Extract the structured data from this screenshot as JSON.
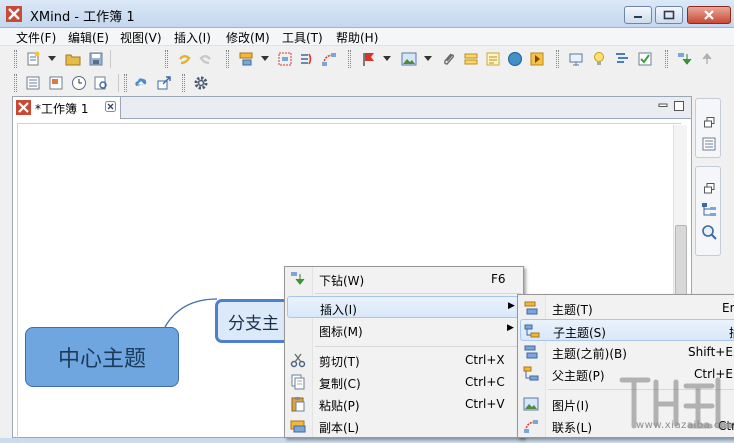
{
  "window": {
    "title": "XMind - 工作簿 1",
    "accent": "#c84a36"
  },
  "menubar": {
    "items": [
      "文件(F)",
      "编辑(E)",
      "视图(V)",
      "插入(I)",
      "修改(M)",
      "工具(T)",
      "帮助(H)"
    ]
  },
  "toolbar": {
    "icons": [
      "new-workbook-icon",
      "open-icon",
      "save-icon",
      "undo-icon",
      "redo-icon",
      "add-topic-icon",
      "insert-subtopic-icon",
      "boundary-icon",
      "summary-icon",
      "relationship-icon",
      "marker-flag-icon",
      "image-icon",
      "attachment-icon",
      "label-icon",
      "notes-icon",
      "hyperlink-globe-icon",
      "audio-icon",
      "presentation-icon",
      "idea-bulb-icon",
      "gantt-icon",
      "task-icon",
      "drill-down-icon",
      "drill-up-icon",
      "outline-view-icon",
      "overview-icon",
      "clock-icon",
      "preview-icon",
      "share-upload-icon",
      "export-icon",
      "settings-gear-icon"
    ]
  },
  "editor": {
    "tab_title": "*工作簿 1"
  },
  "mindmap": {
    "central_topic": "中心主题",
    "branch_topic": "分支主"
  },
  "context_menu": {
    "items": [
      {
        "label": "下钻(W)",
        "shortcut": "F6",
        "icon": "drill-down-icon"
      },
      {
        "label": "插入(I)",
        "shortcut": "",
        "icon": "",
        "submenu": true
      },
      {
        "label": "图标(M)",
        "shortcut": "",
        "icon": "",
        "submenu": true
      },
      {
        "label": "剪切(T)",
        "shortcut": "Ctrl+X",
        "icon": "cut-icon"
      },
      {
        "label": "复制(C)",
        "shortcut": "Ctrl+C",
        "icon": "copy-icon"
      },
      {
        "label": "粘贴(P)",
        "shortcut": "Ctrl+V",
        "icon": "paste-icon"
      },
      {
        "label": "副本(L)",
        "shortcut": "",
        "icon": "duplicate-icon"
      }
    ]
  },
  "submenu": {
    "items": [
      {
        "label": "主题(T)",
        "shortcut": "En",
        "icon": "topic-icon"
      },
      {
        "label": "子主题(S)",
        "shortcut": "插",
        "icon": "subtopic-icon"
      },
      {
        "label": "主题(之前)(B)",
        "shortcut": "Shift+En",
        "icon": "topic-before-icon"
      },
      {
        "label": "父主题(P)",
        "shortcut": "Ctrl+En",
        "icon": "parent-topic-icon"
      },
      {
        "label": "图片(I)",
        "shortcut": "",
        "icon": "picture-icon"
      },
      {
        "label": "联系(L)",
        "shortcut": "Ctrl",
        "icon": "relationship-icon"
      }
    ]
  },
  "watermark": {
    "text": "www.xiazaiba.com"
  }
}
